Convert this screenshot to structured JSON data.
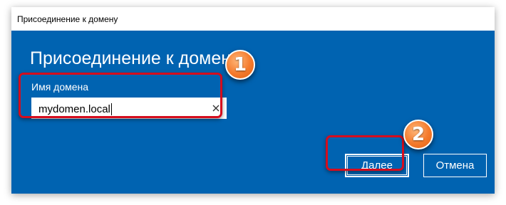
{
  "window": {
    "titlebar_text": "Присоединение к домену"
  },
  "dialog": {
    "title": "Присоединение к домену",
    "field_label": "Имя домена",
    "domain_value": "mydomen.local",
    "clear_icon": "close-icon"
  },
  "buttons": {
    "next_label": "Далее",
    "cancel_label": "Отмена"
  },
  "annotations": {
    "badge_1": "1",
    "badge_2": "2",
    "highlight_color": "#d50d1e",
    "badge_color": "#f47a2c"
  },
  "colors": {
    "dialog_background": "#0063b1",
    "titlebar_background": "#ffffff"
  }
}
